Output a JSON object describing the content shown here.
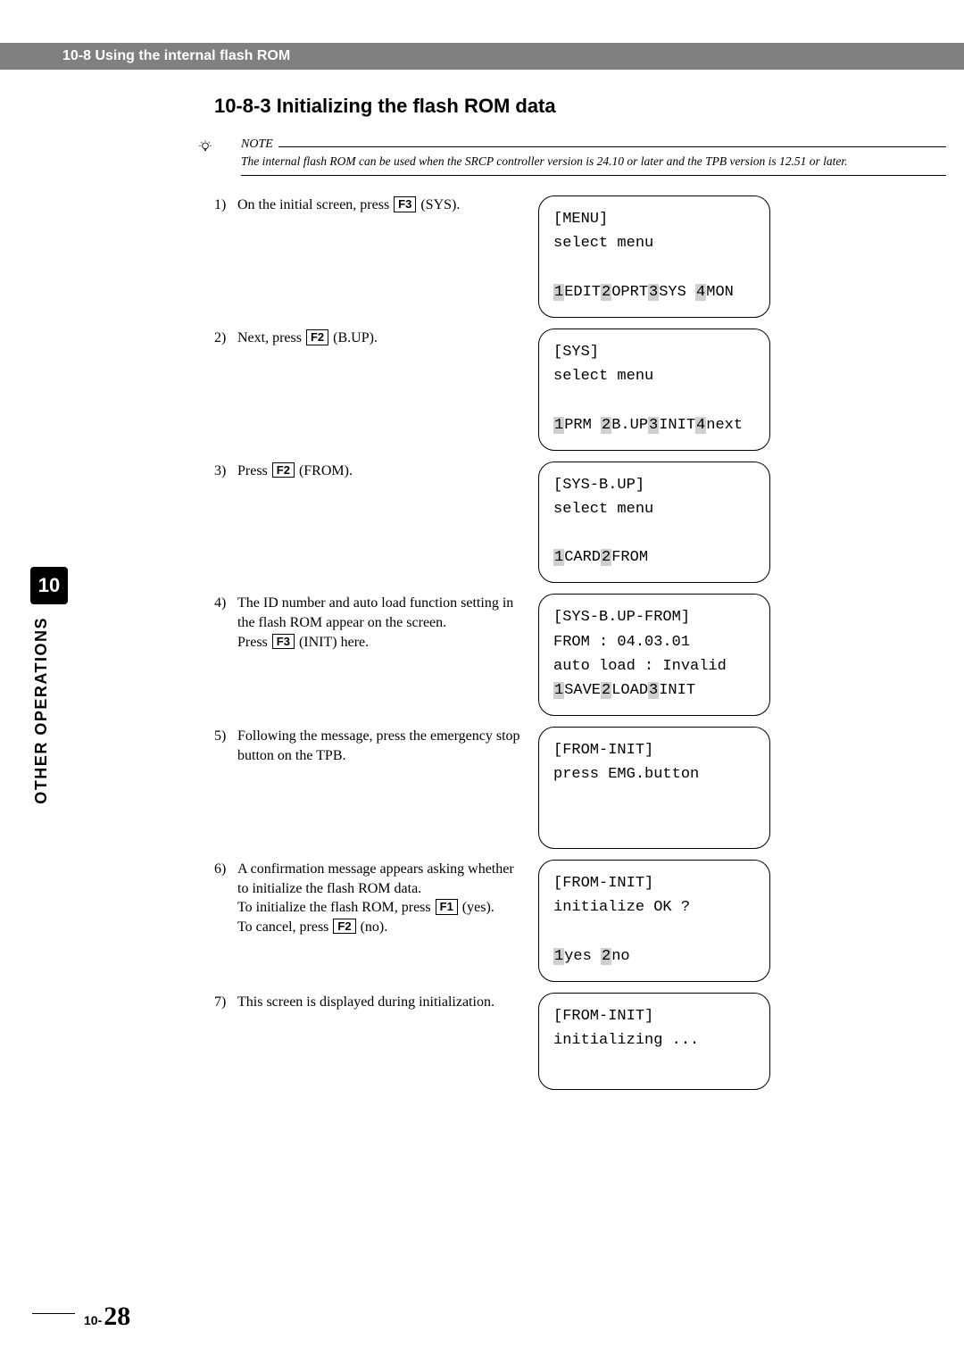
{
  "header": {
    "title": "10-8 Using the internal flash ROM"
  },
  "section": {
    "heading": "10-8-3 Initializing the flash ROM data"
  },
  "note": {
    "label": "NOTE",
    "body": "The internal flash ROM can be used when the SRCP controller version is 24.10 or later and the TPB version is 12.51 or later."
  },
  "steps": [
    {
      "num": "1)",
      "pre1": "On the initial screen, press ",
      "key1": "F3",
      "post1": " (SYS).",
      "screen": {
        "l1": "[MENU]",
        "l2": "select menu",
        "opts": [
          {
            "n": "1",
            "t": "EDIT"
          },
          {
            "n": "2",
            "t": "OPRT"
          },
          {
            "n": "3",
            "t": "SYS "
          },
          {
            "n": "4",
            "t": "MON"
          }
        ]
      }
    },
    {
      "num": "2)",
      "pre1": "Next, press ",
      "key1": "F2",
      "post1": " (B.UP).",
      "screen": {
        "l1": "[SYS]",
        "l2": "select menu",
        "opts": [
          {
            "n": "1",
            "t": "PRM "
          },
          {
            "n": "2",
            "t": "B.UP"
          },
          {
            "n": "3",
            "t": "INIT"
          },
          {
            "n": "4",
            "t": "next"
          }
        ]
      }
    },
    {
      "num": "3)",
      "pre1": "Press ",
      "key1": "F2",
      "post1": " (FROM).",
      "screen": {
        "l1": "[SYS-B.UP]",
        "l2": "select menu",
        "opts": [
          {
            "n": "1",
            "t": "CARD"
          },
          {
            "n": "2",
            "t": "FROM"
          }
        ]
      }
    },
    {
      "num": "4)",
      "pre1": "The ID number and auto load function setting in the flash ROM appear on the screen.",
      "br": true,
      "pre2": "Press ",
      "key1": "F3",
      "post1": " (INIT) here.",
      "screen": {
        "l1": "[SYS-B.UP-FROM]",
        "l2": "FROM : 04.03.01",
        "l3": "auto load : Invalid",
        "opts": [
          {
            "n": "1",
            "t": "SAVE"
          },
          {
            "n": "2",
            "t": "LOAD"
          },
          {
            "n": "3",
            "t": "INIT"
          }
        ]
      }
    },
    {
      "num": "5)",
      "pre1": "Following the message, press the emergency stop button on the TPB.",
      "screen": {
        "l1": "[FROM-INIT]",
        "l2": "press EMG.button"
      }
    },
    {
      "num": "6)",
      "pre1": "A confirmation message appears asking whether to initialize the flash ROM data.",
      "br": true,
      "pre2": "To initialize the flash ROM, press ",
      "key1": "F1",
      "post1": " (yes).",
      "br2": true,
      "pre3": "To cancel, press ",
      "key2": "F2",
      "post2": " (no).",
      "screen": {
        "l1": "[FROM-INIT]",
        "l2": "initialize OK ?",
        "opts": [
          {
            "n": "1",
            "t": "yes "
          },
          {
            "n": "2",
            "t": "no"
          }
        ]
      }
    },
    {
      "num": "7)",
      "pre1": "This screen is displayed during initialization.",
      "screen": {
        "l1": "[FROM-INIT]",
        "l2": "initializing ..."
      }
    }
  ],
  "sidebar": {
    "chapter": "10",
    "label": "OTHER OPERATIONS"
  },
  "footer": {
    "prefix": "10-",
    "page": "28"
  }
}
